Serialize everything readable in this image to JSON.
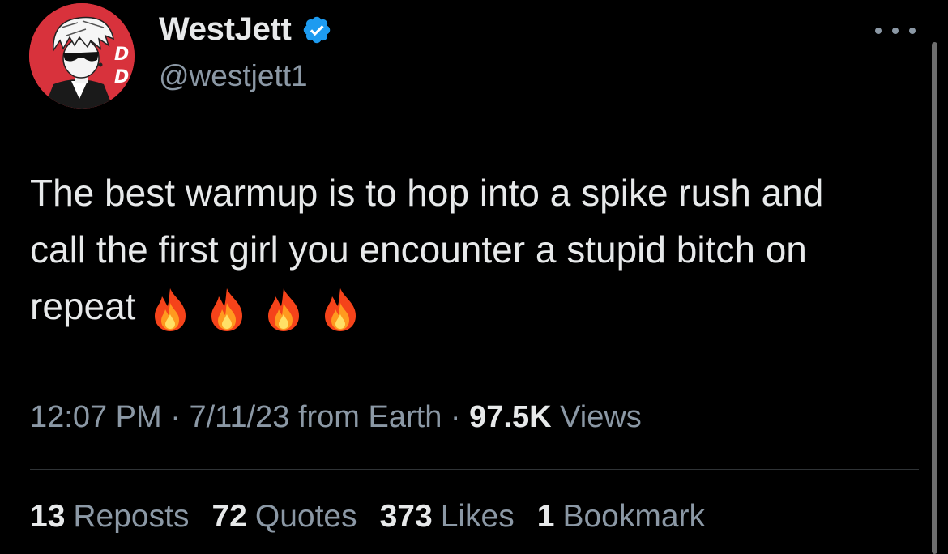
{
  "author": {
    "display_name": "WestJett",
    "handle": "@westjett1",
    "avatar_icon": "avatar-anime-character",
    "verified_icon": "verified-badge-icon",
    "verified_color": "#1d9bf0"
  },
  "tweet": {
    "text_lines": [
      "The best warmup is to hop into a spike rush and",
      "call the first girl you encounter a stupid bitch on",
      "repeat"
    ],
    "emoji_icons": [
      "fire-icon",
      "fire-icon",
      "fire-icon",
      "fire-icon"
    ]
  },
  "meta": {
    "time": "12:07 PM",
    "sep1": " · ",
    "date": "7/11/23",
    "source": " from Earth",
    "sep2": " · ",
    "views_count": "97.5K",
    "views_label": " Views"
  },
  "stats": [
    {
      "count": "13",
      "label": "Reposts"
    },
    {
      "count": "72",
      "label": "Quotes"
    },
    {
      "count": "373",
      "label": "Likes"
    },
    {
      "count": "1",
      "label": "Bookmark"
    }
  ],
  "colors": {
    "background": "#000000",
    "primary_text": "#e7e9ea",
    "secondary_text": "#8b98a5",
    "divider": "#2f3336"
  }
}
